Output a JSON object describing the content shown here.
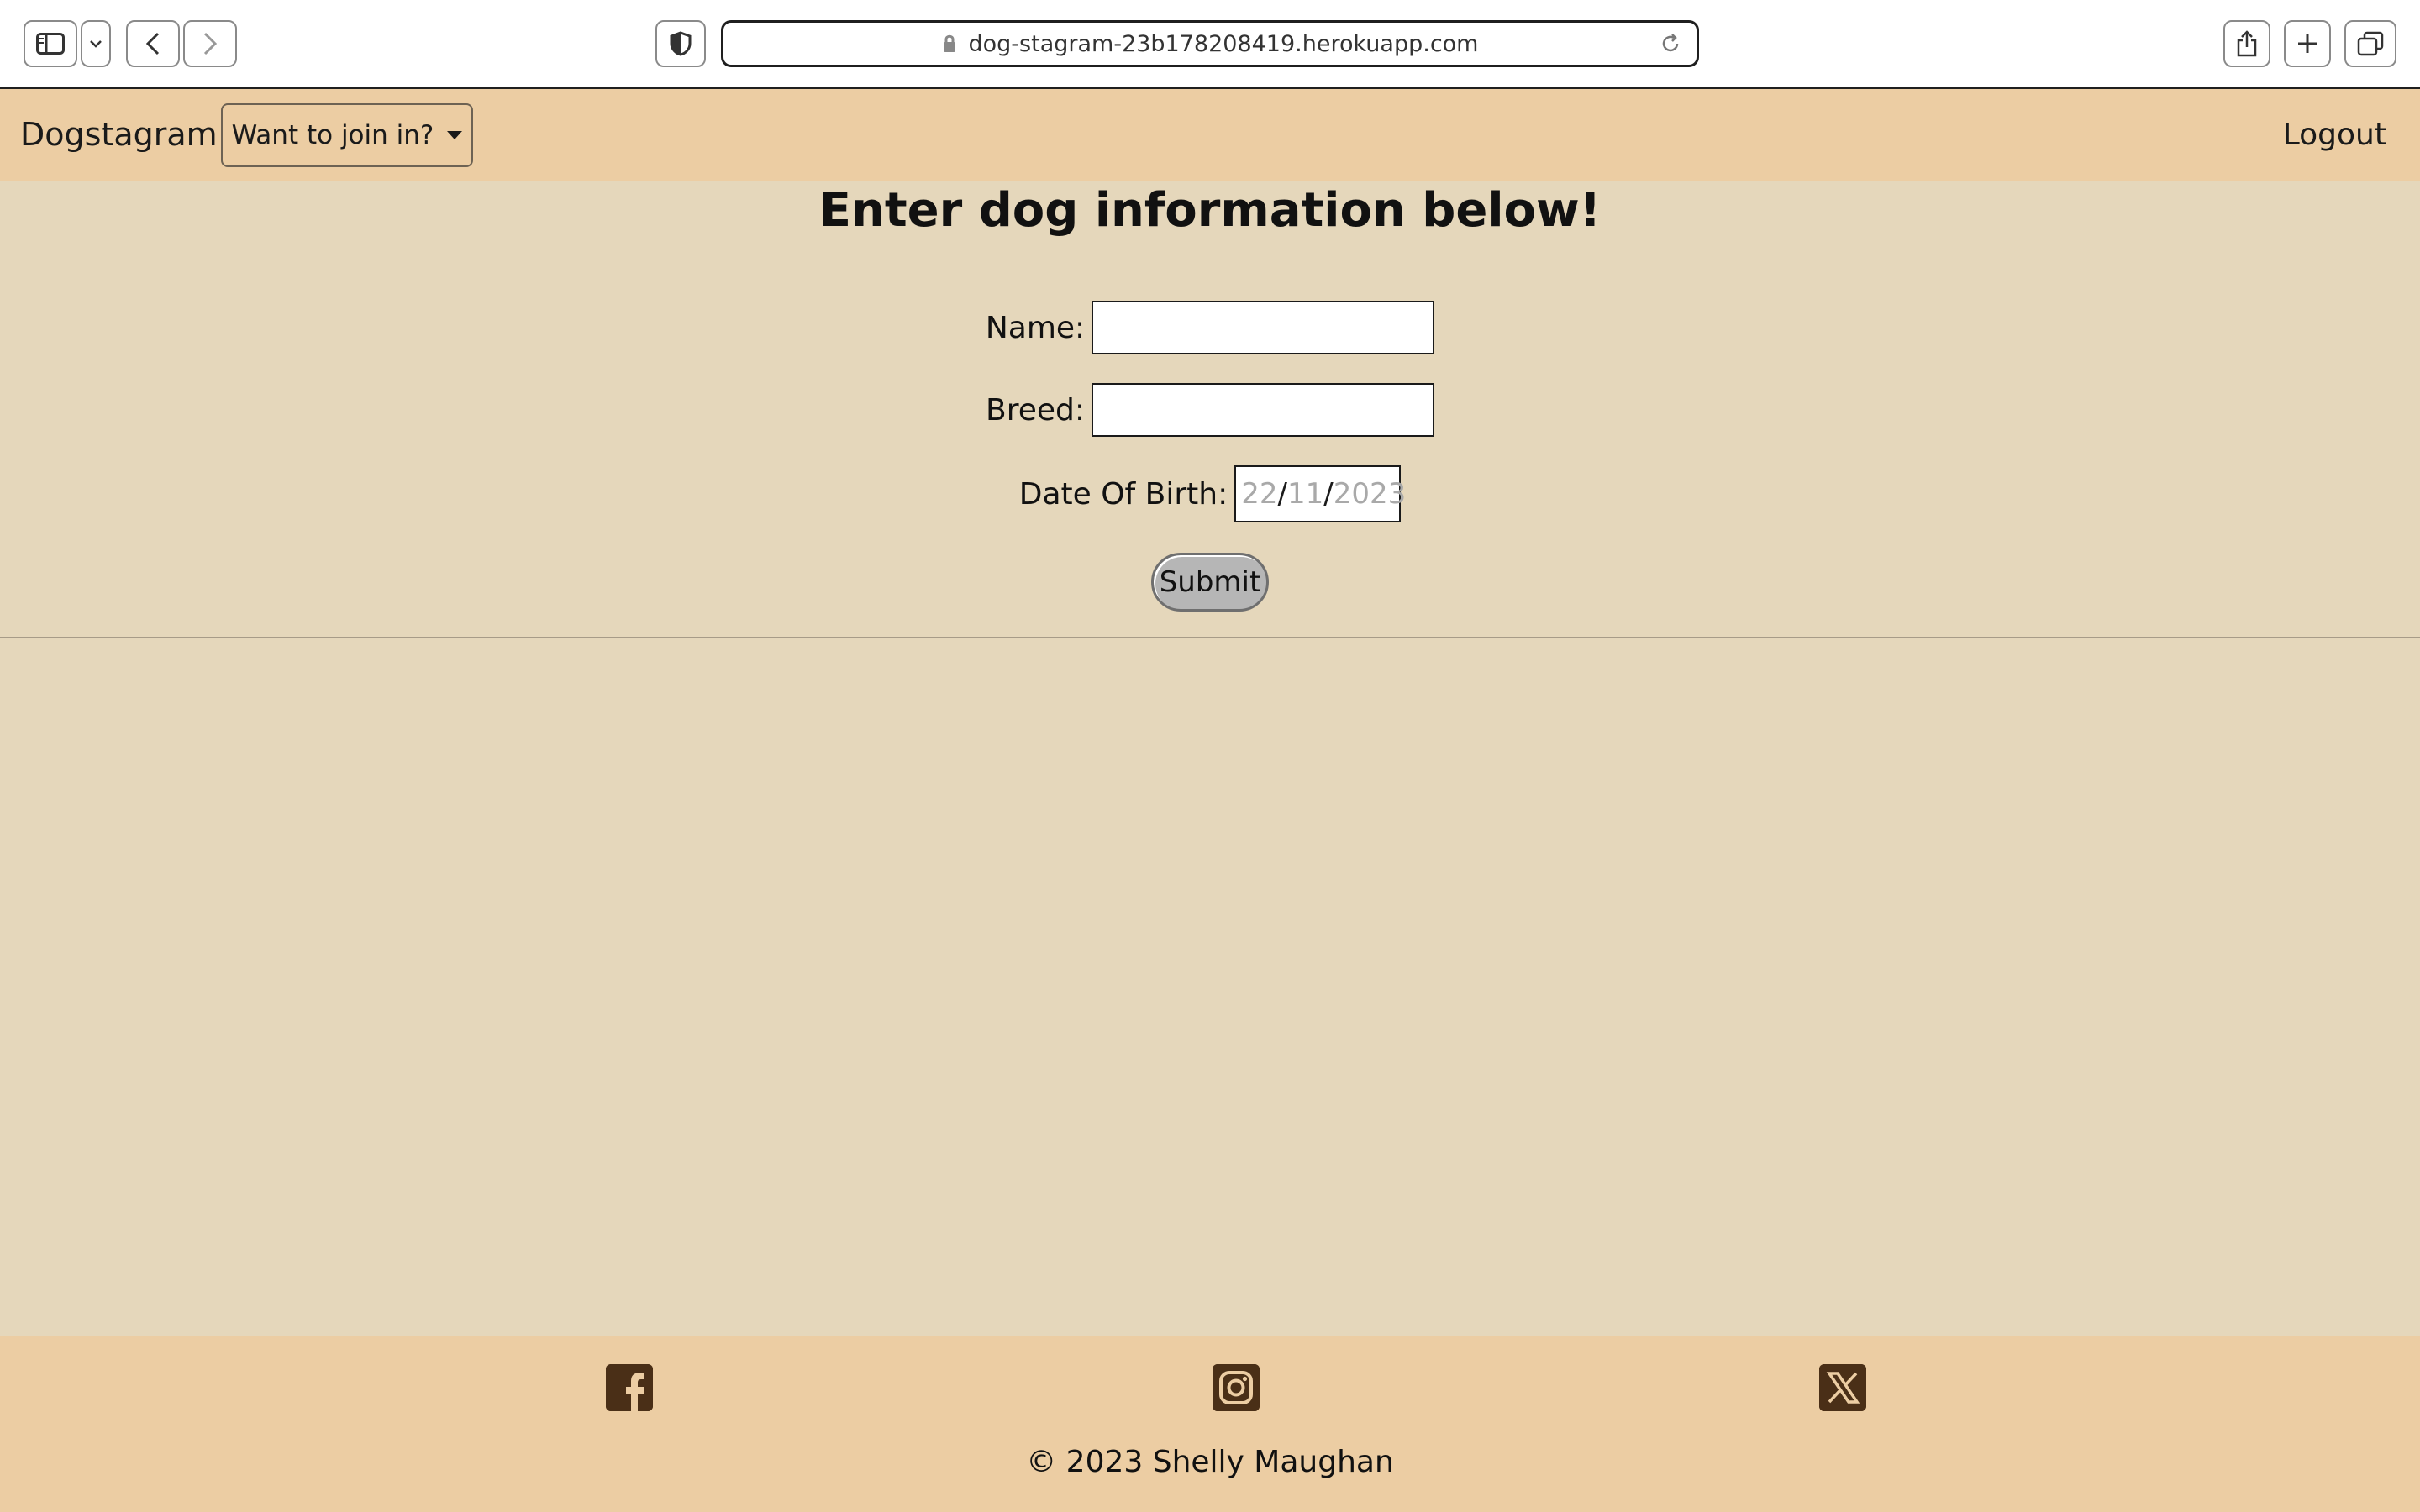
{
  "browser": {
    "url": "dog-stagram-23b178208419.herokuapp.com"
  },
  "navbar": {
    "brand": "Dogstagram",
    "dropdown_label": "Want to join in?",
    "logout_label": "Logout"
  },
  "form": {
    "title": "Enter dog information below!",
    "name_label": "Name:",
    "name_value": "",
    "breed_label": "Breed:",
    "breed_value": "",
    "dob_label": "Date Of Birth:",
    "dob_day": "22",
    "dob_month": "11",
    "dob_year": "2023",
    "dob_separator": "/",
    "submit_label": "Submit"
  },
  "footer": {
    "social_icons": [
      "facebook-icon",
      "instagram-icon",
      "x-icon"
    ],
    "copyright": "© 2023 Shelly Maughan"
  },
  "colors": {
    "nav_footer_bg": "#eccda3",
    "page_bg": "#e5d7bb",
    "icon_brown": "#4a2f17"
  }
}
